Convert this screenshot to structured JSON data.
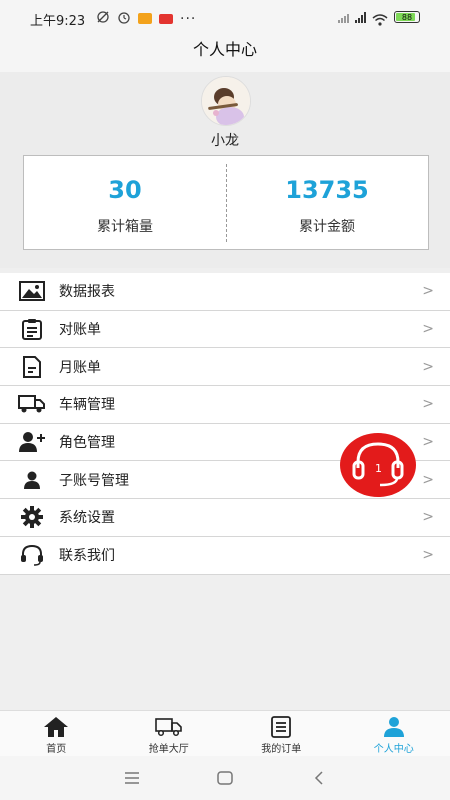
{
  "status_bar": {
    "time": "上午9:23",
    "battery": "88"
  },
  "header": {
    "title": "个人中心"
  },
  "profile": {
    "username": "小龙",
    "stats": [
      {
        "value": "30",
        "label": "累计箱量"
      },
      {
        "value": "13735",
        "label": "累计金额"
      }
    ]
  },
  "menu": {
    "items": [
      {
        "label": "数据报表",
        "icon": "image-icon"
      },
      {
        "label": "对账单",
        "icon": "clipboard-list-icon"
      },
      {
        "label": "月账单",
        "icon": "document-icon"
      },
      {
        "label": "车辆管理",
        "icon": "truck-icon"
      },
      {
        "label": "角色管理",
        "icon": "add-user-icon"
      },
      {
        "label": "子账号管理",
        "icon": "user-icon"
      },
      {
        "label": "系统设置",
        "icon": "gear-icon"
      },
      {
        "label": "联系我们",
        "icon": "headset-icon"
      }
    ],
    "chevron": ">"
  },
  "support_button": {
    "badge": "1",
    "icon": "headset-icon",
    "color": "#e31b1b"
  },
  "tabbar": {
    "tabs": [
      {
        "label": "首页",
        "icon": "home-icon"
      },
      {
        "label": "抢单大厅",
        "icon": "truck-icon"
      },
      {
        "label": "我的订单",
        "icon": "order-list-icon"
      },
      {
        "label": "个人中心",
        "icon": "user-icon"
      }
    ],
    "active_index": 3,
    "accent_color": "#1ea2d8"
  }
}
